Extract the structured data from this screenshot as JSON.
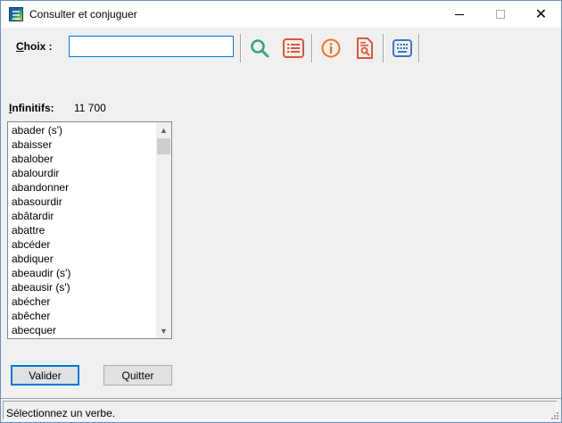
{
  "window": {
    "title": "Consulter et conjuguer",
    "app_icon": "app-icon",
    "minimize_icon": "minimize-icon",
    "maximize_icon": "maximize-icon",
    "close_icon": "close-icon",
    "close_glyph": "✕"
  },
  "toolbar": {
    "choix_label_accel": "C",
    "choix_label_rest": "hoix :",
    "choix_value": "",
    "icons": [
      {
        "name": "search-icon",
        "color": "#3aa37a"
      },
      {
        "name": "list-icon",
        "color": "#d9573b"
      },
      {
        "name": "info-icon",
        "color": "#e8732b"
      },
      {
        "name": "document-search-icon",
        "color": "#d9573b"
      },
      {
        "name": "keyboard-icon",
        "color": "#3a78c2"
      }
    ]
  },
  "infinitifs": {
    "label_accel": "I",
    "label_rest": "nfinitifs:",
    "count": "11 700"
  },
  "verbs": [
    "abader (s')",
    "abaisser",
    "abalober",
    "abalourdir",
    "abandonner",
    "abasourdir",
    "abâtardir",
    "abattre",
    "abcéder",
    "abdiquer",
    "abeaudir (s')",
    "abeausir (s')",
    "abécher",
    "abêcher",
    "abecquer"
  ],
  "scrollbar": {
    "up_glyph": "▲",
    "down_glyph": "▼"
  },
  "buttons": {
    "valider": "Valider",
    "quitter": "Quitter"
  },
  "status": {
    "text": "Sélectionnez un verbe."
  },
  "colors": {
    "accent": "#0078d7",
    "window_bg": "#f0f0f0"
  }
}
